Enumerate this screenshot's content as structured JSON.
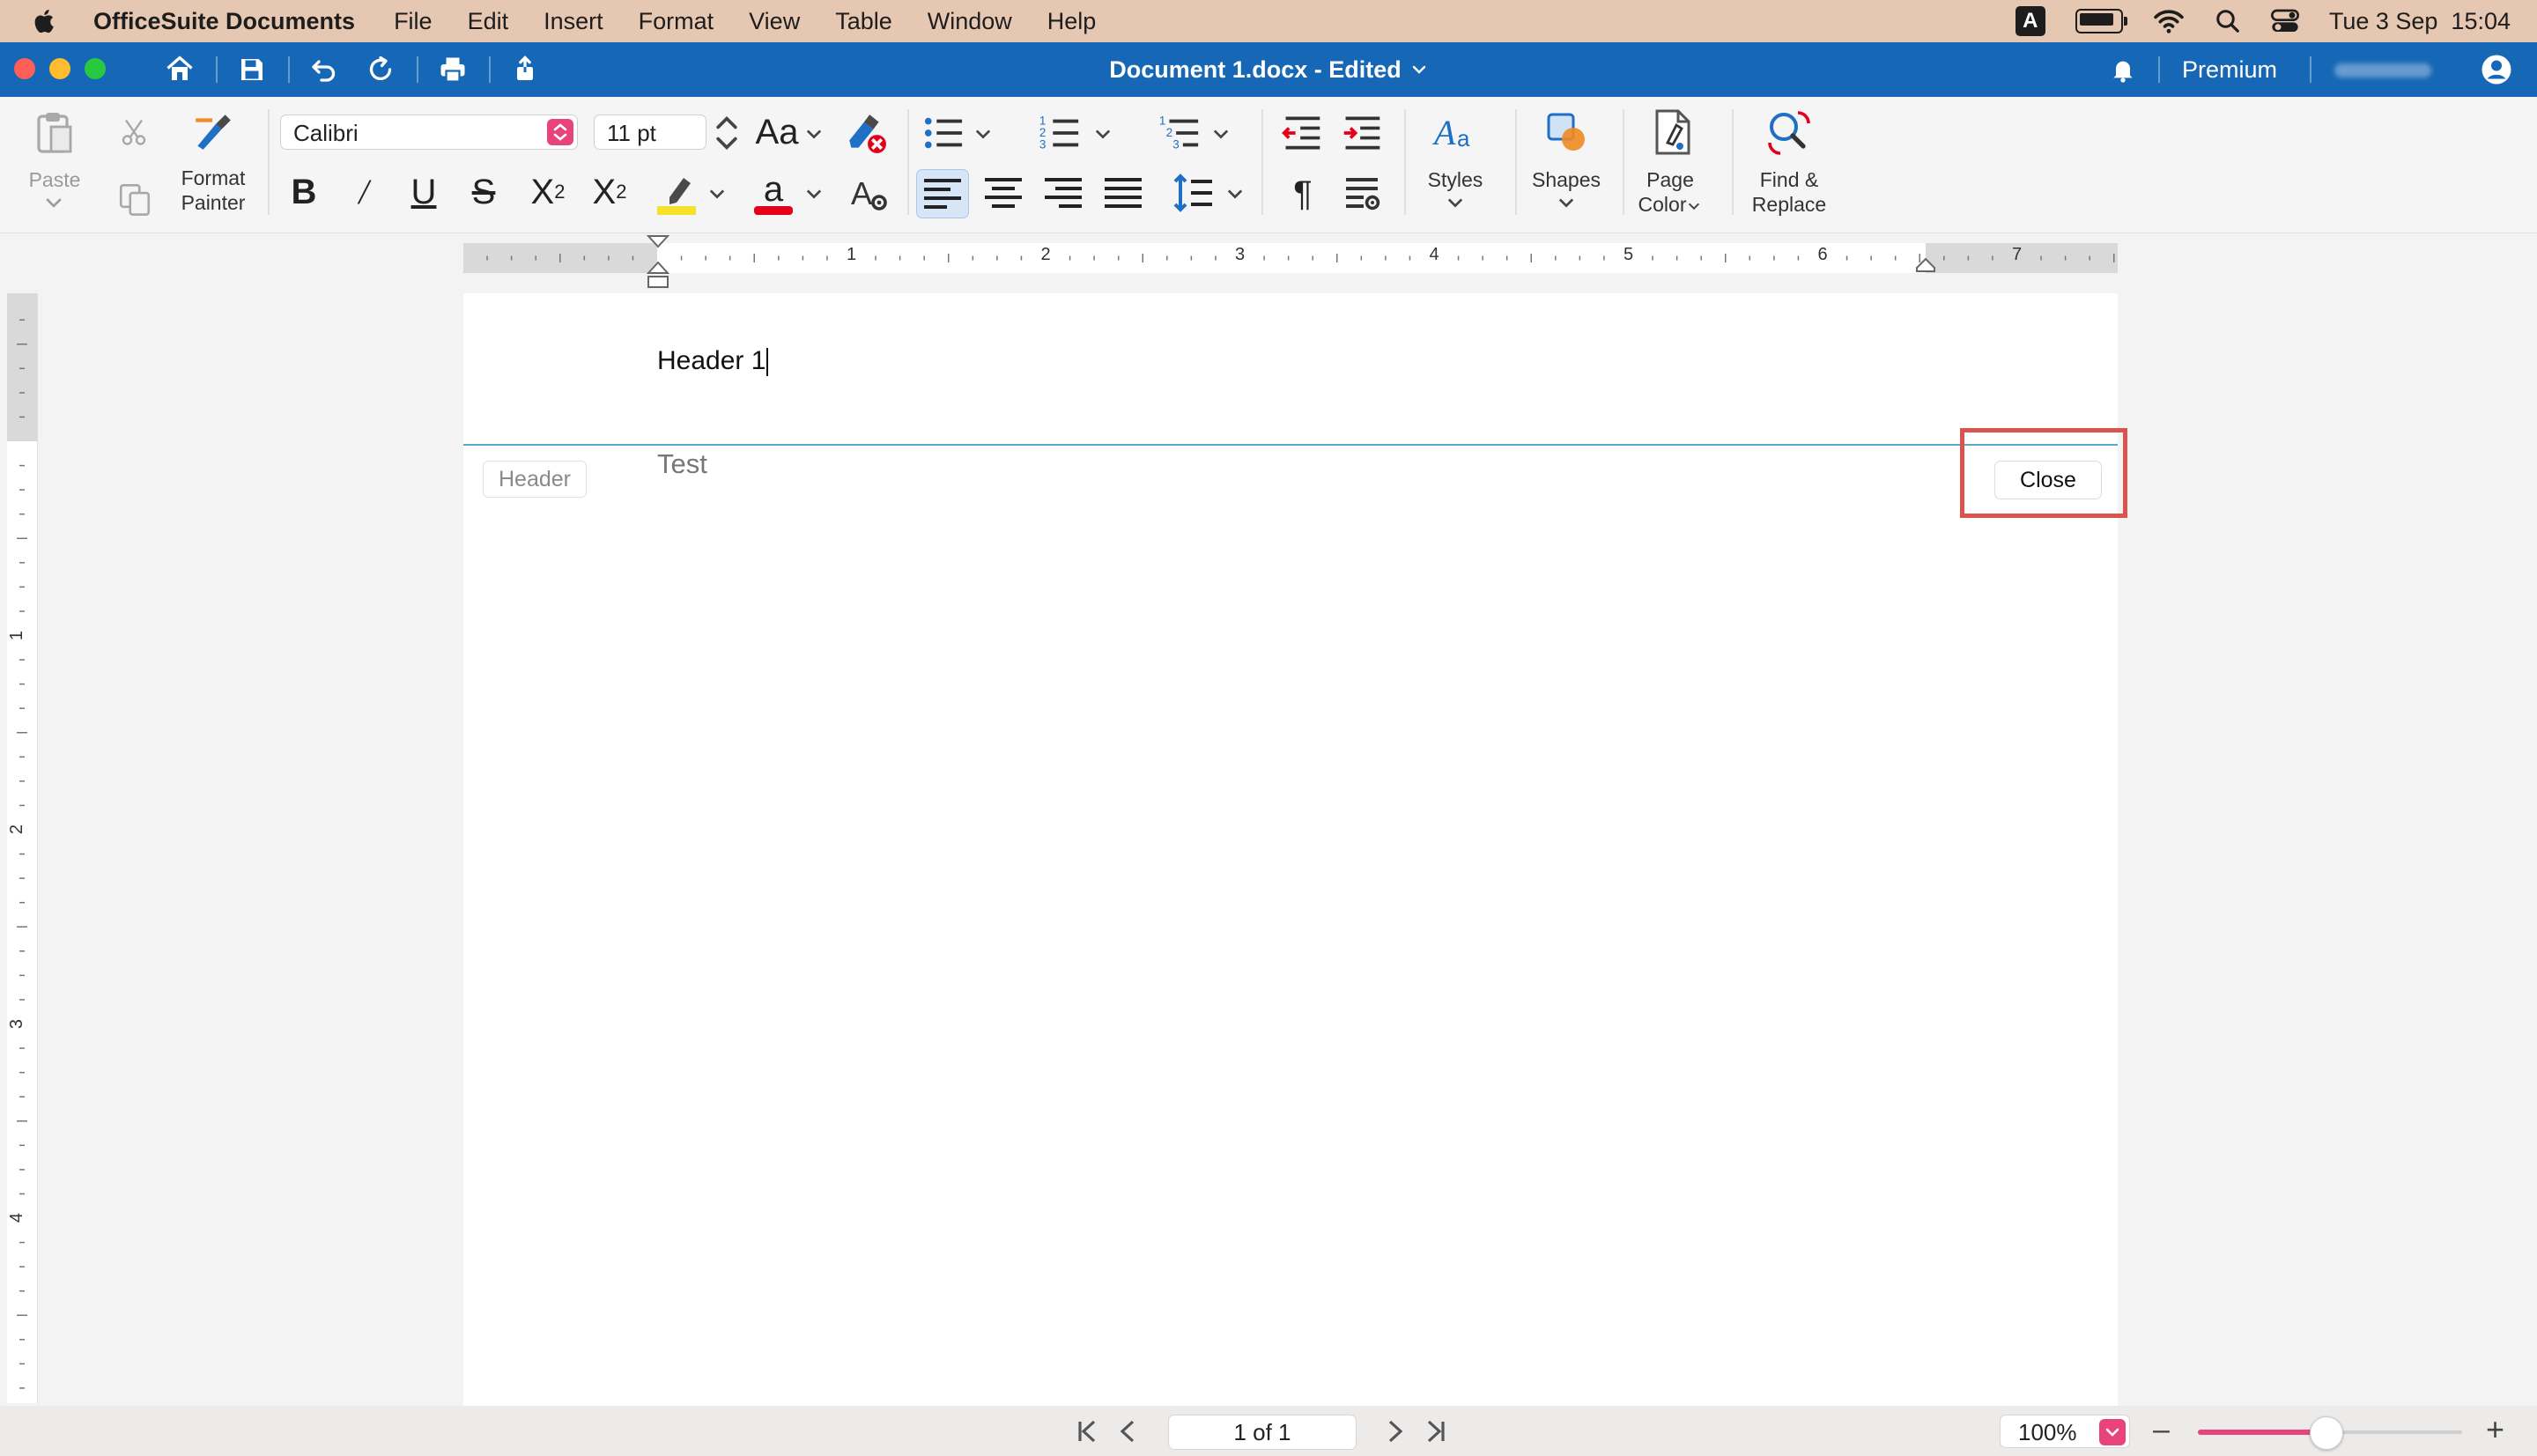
{
  "menubar": {
    "app_name": "OfficeSuite Documents",
    "items": [
      "File",
      "Edit",
      "Insert",
      "Format",
      "View",
      "Table",
      "Window",
      "Help"
    ],
    "input_indicator": "A",
    "clock": "Tue 3 Sep  15:04"
  },
  "titlebar": {
    "document_title": "Document 1.docx - Edited",
    "premium_label": "Premium"
  },
  "ribbon": {
    "paste_label": "Paste",
    "format_painter_label": [
      "Format",
      "Painter"
    ],
    "font_name": "Calibri",
    "font_size": "11 pt",
    "change_case_label": "Aa",
    "styles_label": "Styles",
    "shapes_label": "Shapes",
    "page_color_label": [
      "Page",
      "Color"
    ],
    "find_replace_label": [
      "Find &",
      "Replace"
    ],
    "highlight_color": "#f5e22b",
    "font_color": "#e3001b"
  },
  "ruler": {
    "h_labels": [
      "1",
      "2",
      "3",
      "4",
      "5",
      "6",
      "7"
    ],
    "v_labels": [
      "1",
      "2",
      "3",
      "4"
    ]
  },
  "document": {
    "header_text": "Header 1",
    "header_tag": "Header",
    "body_text": "Test",
    "close_label": "Close"
  },
  "statusbar": {
    "page_indicator": "1 of 1",
    "zoom": "100%",
    "zoom_level_percent": 100
  },
  "colors": {
    "titlebar_blue": "#1667b6",
    "accent_pink": "#e8447b",
    "header_rule": "#5aa9c9",
    "annotation_red": "#d9534f"
  }
}
